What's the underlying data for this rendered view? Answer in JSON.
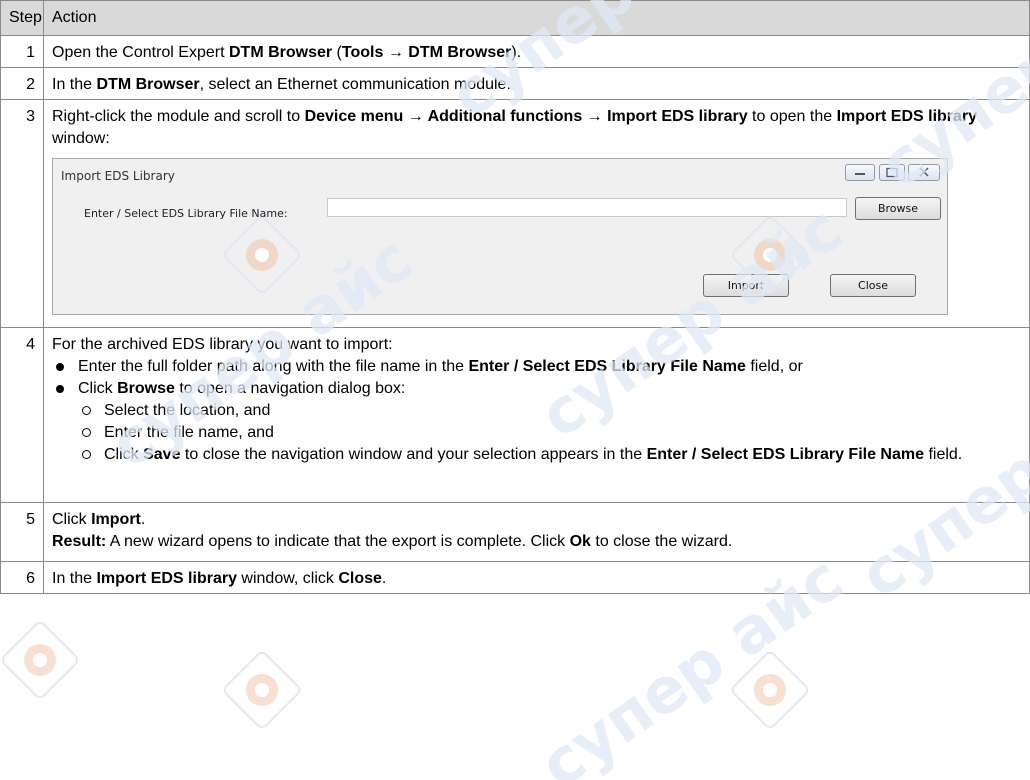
{
  "table": {
    "header": {
      "step": "Step",
      "action": "Action"
    },
    "steps": [
      {
        "num": "1",
        "parts": [
          {
            "t": "Open the Control Expert "
          },
          {
            "t": "DTM Browser",
            "b": true
          },
          {
            "t": " ("
          },
          {
            "t": "Tools → DTM Browser",
            "b": true
          },
          {
            "t": ")."
          }
        ]
      },
      {
        "num": "2",
        "parts": [
          {
            "t": "In the "
          },
          {
            "t": "DTM Browser",
            "b": true
          },
          {
            "t": ", select an Ethernet communication module."
          }
        ]
      },
      {
        "num": "3",
        "parts": [
          {
            "t": "Right-click the module and scroll to "
          },
          {
            "t": "Device menu → Additional functions → Import EDS library",
            "b": true
          },
          {
            "t": " to open the "
          },
          {
            "t": "Import EDS library",
            "b": true
          },
          {
            "t": " window:"
          }
        ]
      },
      {
        "num": "4",
        "intro": "For the archived EDS library you want to import:",
        "bullets": [
          [
            {
              "t": "Enter the full folder path along with the file name in the "
            },
            {
              "t": "Enter / Select EDS Library File Name",
              "b": true
            },
            {
              "t": " field, or"
            }
          ],
          [
            {
              "t": "Click "
            },
            {
              "t": "Browse",
              "b": true
            },
            {
              "t": " to open a navigation dialog box:"
            }
          ]
        ],
        "sub_bullets": [
          [
            {
              "t": "Select the location, and"
            }
          ],
          [
            {
              "t": "Enter the file name, and"
            }
          ],
          [
            {
              "t": "Click "
            },
            {
              "t": "Save",
              "b": true
            },
            {
              "t": " to close the navigation window and your selection appears in the "
            },
            {
              "t": "Enter / Select EDS Library File Name",
              "b": true
            },
            {
              "t": " field."
            }
          ]
        ]
      },
      {
        "num": "5",
        "line1": [
          {
            "t": "Click "
          },
          {
            "t": "Import",
            "b": true
          },
          {
            "t": "."
          }
        ],
        "line2": [
          {
            "t": "Result:",
            "b": true
          },
          {
            "t": " A new wizard opens to indicate that the export is complete. Click "
          },
          {
            "t": "Ok",
            "b": true
          },
          {
            "t": " to close the wizard."
          }
        ]
      },
      {
        "num": "6",
        "parts": [
          {
            "t": "In the "
          },
          {
            "t": "Import EDS library",
            "b": true
          },
          {
            "t": " window, click "
          },
          {
            "t": "Close",
            "b": true
          },
          {
            "t": "."
          }
        ]
      }
    ]
  },
  "dialog": {
    "title": "Import EDS Library",
    "field_label": "Enter / Select EDS Library File Name:",
    "field_value": "",
    "browse_label": "Browse",
    "import_label": "Import",
    "close_label": "Close"
  },
  "watermark": {
    "text": "супер айс",
    "color": "#3f74c2"
  }
}
